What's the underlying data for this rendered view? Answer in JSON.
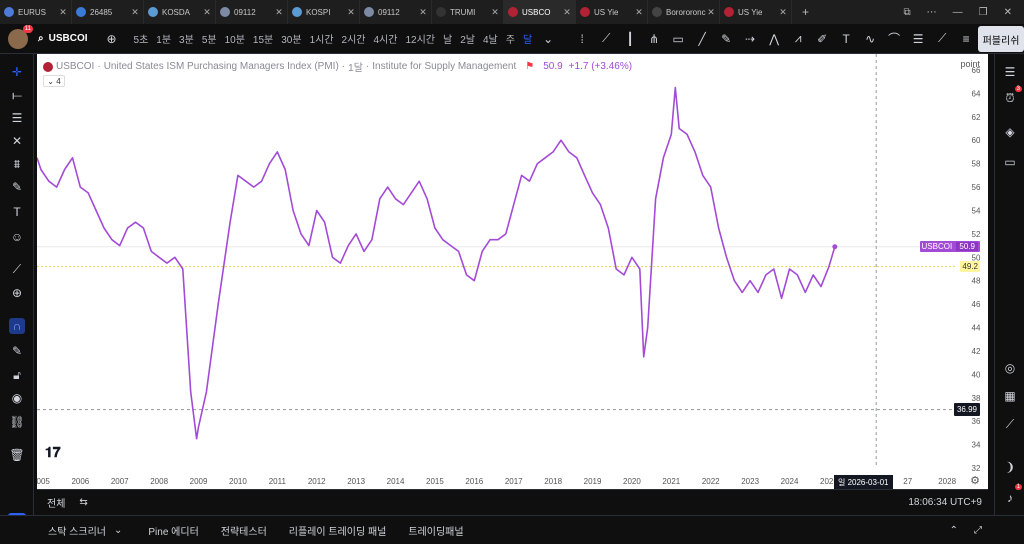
{
  "browser_tabs": [
    {
      "title": "EURUS",
      "color": "#4f7bd8"
    },
    {
      "title": "26485",
      "color": "#3a7bd5"
    },
    {
      "title": "KOSDA",
      "color": "#5c9bd1"
    },
    {
      "title": "09112",
      "color": "#7c8aa5"
    },
    {
      "title": "KOSPI",
      "color": "#5c9bd1"
    },
    {
      "title": "09112",
      "color": "#7c8aa5"
    },
    {
      "title": "TRUMI",
      "color": "#333333"
    },
    {
      "title": "USBCO",
      "color": "#b22234",
      "active": true
    },
    {
      "title": "US Yie",
      "color": "#b22234"
    },
    {
      "title": "Borororonc",
      "color": "#444444"
    },
    {
      "title": "US Yie",
      "color": "#b22234"
    }
  ],
  "toolbar": {
    "avatar_badge": "11",
    "symbol": "USBCOI",
    "timeframes": [
      "5초",
      "1분",
      "3분",
      "5분",
      "10분",
      "15분",
      "30분",
      "1시간",
      "2시간",
      "4시간",
      "12시간",
      "날",
      "2날",
      "4날",
      "주",
      "달"
    ],
    "active_timeframe": "달",
    "publish_label": "퍼블리쉬"
  },
  "chart": {
    "legend_symbol": "USBCOI",
    "legend_name": "United States ISM Purchasing Managers Index (PMI)",
    "legend_interval": "1달",
    "legend_source": "Institute for Supply Management",
    "legend_value": "50.9",
    "legend_change": "+1.7 (+3.46%)",
    "indicator_count": "4",
    "unit_label": "point",
    "price_tag_label": "USBCOI",
    "price_tag_value": "50.9",
    "level_tag_value": "49.2",
    "crosshair_value": "36.99",
    "crosshair_date": "일 2026-03-01",
    "line_color": "#a34bd6",
    "y_ticks": [
      "66",
      "64",
      "62",
      "60",
      "58",
      "56",
      "54",
      "52",
      "50",
      "48",
      "46",
      "44",
      "42",
      "40",
      "38",
      "36",
      "34",
      "32"
    ],
    "x_ticks": [
      "2005",
      "2006",
      "2007",
      "2008",
      "2009",
      "2010",
      "2011",
      "2012",
      "2013",
      "2014",
      "2015",
      "2016",
      "2017",
      "2018",
      "2019",
      "2020",
      "2021",
      "2022",
      "2023",
      "2024",
      "2025",
      "27",
      "2028"
    ]
  },
  "chart_data": {
    "type": "line",
    "series": [
      {
        "name": "USBCOI",
        "x": [
          2004.9,
          2005.0,
          2005.2,
          2005.4,
          2005.6,
          2005.8,
          2006.0,
          2006.2,
          2006.4,
          2006.6,
          2006.8,
          2007.0,
          2007.2,
          2007.4,
          2007.6,
          2007.8,
          2008.0,
          2008.2,
          2008.4,
          2008.6,
          2008.8,
          2008.95,
          2009.0,
          2009.2,
          2009.5,
          2009.8,
          2010.0,
          2010.2,
          2010.4,
          2010.6,
          2010.8,
          2011.0,
          2011.2,
          2011.4,
          2011.6,
          2011.8,
          2012.0,
          2012.2,
          2012.4,
          2012.6,
          2012.8,
          2013.0,
          2013.2,
          2013.4,
          2013.6,
          2013.8,
          2014.0,
          2014.2,
          2014.4,
          2014.6,
          2014.8,
          2015.0,
          2015.2,
          2015.4,
          2015.6,
          2015.8,
          2016.0,
          2016.2,
          2016.4,
          2016.6,
          2016.8,
          2017.0,
          2017.2,
          2017.4,
          2017.6,
          2017.8,
          2018.0,
          2018.2,
          2018.4,
          2018.6,
          2018.8,
          2019.0,
          2019.2,
          2019.4,
          2019.6,
          2019.8,
          2020.0,
          2020.2,
          2020.3,
          2020.4,
          2020.6,
          2020.8,
          2021.0,
          2021.1,
          2021.2,
          2021.4,
          2021.6,
          2021.8,
          2022.0,
          2022.2,
          2022.4,
          2022.6,
          2022.8,
          2023.0,
          2023.2,
          2023.4,
          2023.6,
          2023.8,
          2024.0,
          2024.2,
          2024.4,
          2024.6,
          2024.8,
          2025.0,
          2025.15
        ],
        "values": [
          58.5,
          57.5,
          56.5,
          56.0,
          57.5,
          58.5,
          56.0,
          55.5,
          54.0,
          52.5,
          51.5,
          51.0,
          52.5,
          53.0,
          52.5,
          50.5,
          50.0,
          49.5,
          50.0,
          49.0,
          38.5,
          34.5,
          35.5,
          38.5,
          46.0,
          53.0,
          57.0,
          56.5,
          56.0,
          56.5,
          58.0,
          59.0,
          57.5,
          54.0,
          52.0,
          51.0,
          54.0,
          53.0,
          50.0,
          49.5,
          51.0,
          52.0,
          50.5,
          51.5,
          55.0,
          56.0,
          55.0,
          54.5,
          55.5,
          56.5,
          55.0,
          52.5,
          51.5,
          51.0,
          50.5,
          48.5,
          48.0,
          50.5,
          51.5,
          51.5,
          52.0,
          54.5,
          57.0,
          56.5,
          58.0,
          58.5,
          59.0,
          60.0,
          59.0,
          58.5,
          57.0,
          55.5,
          54.5,
          52.5,
          49.0,
          48.5,
          50.0,
          49.0,
          41.5,
          44.0,
          55.0,
          58.5,
          60.5,
          64.5,
          61.0,
          60.5,
          59.0,
          57.0,
          56.0,
          52.5,
          50.0,
          48.0,
          47.0,
          48.0,
          47.0,
          48.5,
          49.0,
          46.5,
          49.0,
          48.5,
          47.0,
          48.5,
          47.5,
          49.2,
          50.9
        ]
      }
    ],
    "ylim": [
      32,
      66
    ],
    "xlim": [
      2004.9,
      2028.2
    ]
  },
  "range_bar": {
    "all_label": "전체",
    "time": "18:06:34 UTC+9"
  },
  "bottom_bar": {
    "items": [
      "스탁 스크리너",
      "Pine 에디터",
      "전략테스터",
      "리플레이 트레이딩 패널",
      "트레이딩패널"
    ]
  },
  "sidebar_badges": {
    "alerts": "3",
    "notifications": "1"
  }
}
